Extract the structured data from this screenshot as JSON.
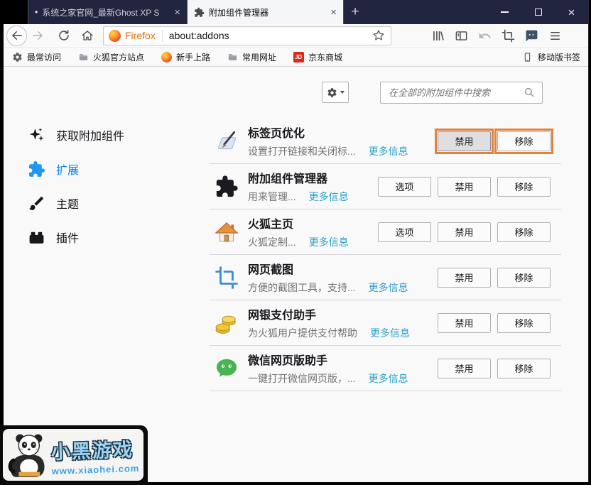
{
  "window": {
    "tab1": {
      "bullet": "•",
      "title": "系统之家官网_最新Ghost XP S"
    },
    "tab2": {
      "title": "附加组件管理器"
    }
  },
  "navbar": {
    "brand": "Firefox",
    "url": "about:addons"
  },
  "bookmarks": {
    "items": [
      {
        "label": "最常访问",
        "icon": "gear"
      },
      {
        "label": "火狐官方站点",
        "icon": "folder"
      },
      {
        "label": "新手上路",
        "icon": "firefox"
      },
      {
        "label": "常用网址",
        "icon": "folder"
      },
      {
        "label": "京东商城",
        "icon": "jd"
      }
    ],
    "jd_label": "JD",
    "mobile": {
      "label": "移动版书签",
      "icon": "phone"
    }
  },
  "addons_page": {
    "search_placeholder": "在全部的附加组件中搜索",
    "more_info_label": "更多信息",
    "sidebar": [
      {
        "label": "获取附加组件",
        "icon": "sparkle",
        "selected": false
      },
      {
        "label": "扩展",
        "icon": "puzzle",
        "selected": true
      },
      {
        "label": "主题",
        "icon": "brush",
        "selected": false
      },
      {
        "label": "插件",
        "icon": "brick",
        "selected": false
      }
    ],
    "addons": [
      {
        "name": "标签页优化",
        "desc": "设置打开链接和关闭标...",
        "icon": "tabopt",
        "highlight": true,
        "buttons": [
          {
            "label": "禁用",
            "pressed": true
          },
          {
            "label": "移除"
          }
        ]
      },
      {
        "name": "附加组件管理器",
        "desc": "用来管理...",
        "icon": "puzzle_black",
        "buttons": [
          {
            "label": "选项"
          },
          {
            "label": "禁用"
          },
          {
            "label": "移除"
          }
        ]
      },
      {
        "name": "火狐主页",
        "desc": "火狐定制...",
        "icon": "house",
        "buttons": [
          {
            "label": "选项"
          },
          {
            "label": "禁用"
          },
          {
            "label": "移除"
          }
        ]
      },
      {
        "name": "网页截图",
        "desc": "方便的截图工具，支持...",
        "icon": "crop_blue",
        "buttons": [
          {
            "label": "禁用"
          },
          {
            "label": "移除"
          }
        ]
      },
      {
        "name": "网银支付助手",
        "desc": "为火狐用户提供支付帮助",
        "icon": "coins",
        "buttons": [
          {
            "label": "禁用"
          },
          {
            "label": "移除"
          }
        ]
      },
      {
        "name": "微信网页版助手",
        "desc": "一键打开微信网页版，...",
        "icon": "wechat",
        "buttons": [
          {
            "label": "禁用"
          },
          {
            "label": "移除"
          }
        ]
      }
    ]
  },
  "watermark": {
    "title": "小黑游戏",
    "url": "www.xiaohei.com"
  },
  "colors": {
    "titlebar": "#22253f",
    "chrome_bg": "#f9f9fa",
    "accent_blue": "#0a84ff",
    "link_blue": "#2aa0c9",
    "highlight_orange": "#e0843c"
  }
}
